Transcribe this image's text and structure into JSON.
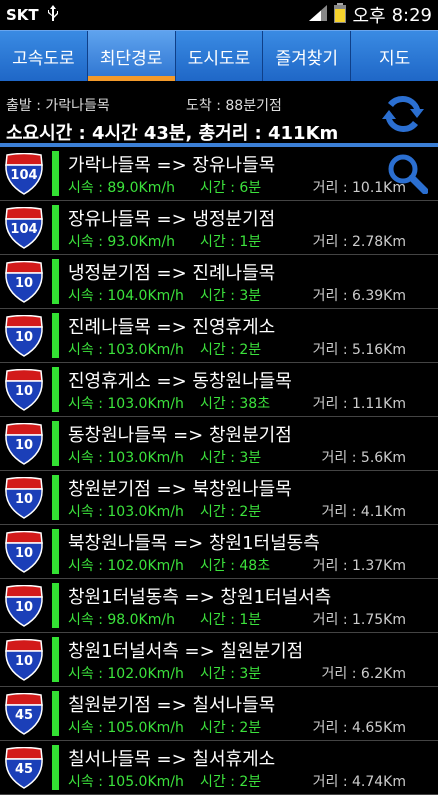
{
  "status": {
    "carrier": "SKT",
    "ampm": "오후",
    "time": "8:29"
  },
  "tabs": [
    {
      "label": "고속도로"
    },
    {
      "label": "최단경로",
      "active": true
    },
    {
      "label": "도시도로"
    },
    {
      "label": "즐겨찾기"
    },
    {
      "label": "지도"
    }
  ],
  "summary": {
    "origin": "출발 : 가락나들목",
    "destination": "도착 : 88분기점",
    "total": "소요시간 : 4시간 43분,  총거리 : 411Km"
  },
  "routes": [
    {
      "road": "104",
      "title": "가락나들목 => 장유나들목",
      "speed": "시속 : 89.0Km/h",
      "time": "시간 : 6분",
      "dist": "거리 : 10.1Km"
    },
    {
      "road": "104",
      "title": "장유나들목 => 냉정분기점",
      "speed": "시속 : 93.0Km/h",
      "time": "시간 : 1분",
      "dist": "거리 : 2.78Km"
    },
    {
      "road": "10",
      "title": "냉정분기점 => 진례나들목",
      "speed": "시속 : 104.0Km/h",
      "time": "시간 : 3분",
      "dist": "거리 : 6.39Km"
    },
    {
      "road": "10",
      "title": "진례나들목 => 진영휴게소",
      "speed": "시속 : 103.0Km/h",
      "time": "시간 : 2분",
      "dist": "거리 : 5.16Km"
    },
    {
      "road": "10",
      "title": "진영휴게소 => 동창원나들목",
      "speed": "시속 : 103.0Km/h",
      "time": "시간 : 38초",
      "dist": "거리 : 1.11Km"
    },
    {
      "road": "10",
      "title": "동창원나들목 => 창원분기점",
      "speed": "시속 : 103.0Km/h",
      "time": "시간 : 3분",
      "dist": "거리 : 5.6Km"
    },
    {
      "road": "10",
      "title": "창원분기점 => 북창원나들목",
      "speed": "시속 : 103.0Km/h",
      "time": "시간 : 2분",
      "dist": "거리 : 4.1Km"
    },
    {
      "road": "10",
      "title": "북창원나들목 => 창원1터널동측",
      "speed": "시속 : 102.0Km/h",
      "time": "시간 : 48초",
      "dist": "거리 : 1.37Km"
    },
    {
      "road": "10",
      "title": "창원1터널동측 => 창원1터널서측",
      "speed": "시속 : 98.0Km/h",
      "time": "시간 : 1분",
      "dist": "거리 : 1.75Km"
    },
    {
      "road": "10",
      "title": "창원1터널서측 => 칠원분기점",
      "speed": "시속 : 102.0Km/h",
      "time": "시간 : 3분",
      "dist": "거리 : 6.2Km"
    },
    {
      "road": "45",
      "title": "칠원분기점 => 칠서나들목",
      "speed": "시속 : 105.0Km/h",
      "time": "시간 : 2분",
      "dist": "거리 : 4.65Km"
    },
    {
      "road": "45",
      "title": "칠서나들목 => 칠서휴게소",
      "speed": "시속 : 105.0Km/h",
      "time": "시간 : 2분",
      "dist": "거리 : 4.74Km"
    }
  ],
  "colors": {
    "tab_bg": "#2c73d0",
    "active_indicator": "#f39a2b",
    "bar": "#33e033",
    "shield_blue": "#1b3fb8",
    "shield_red": "#d21a1a"
  }
}
